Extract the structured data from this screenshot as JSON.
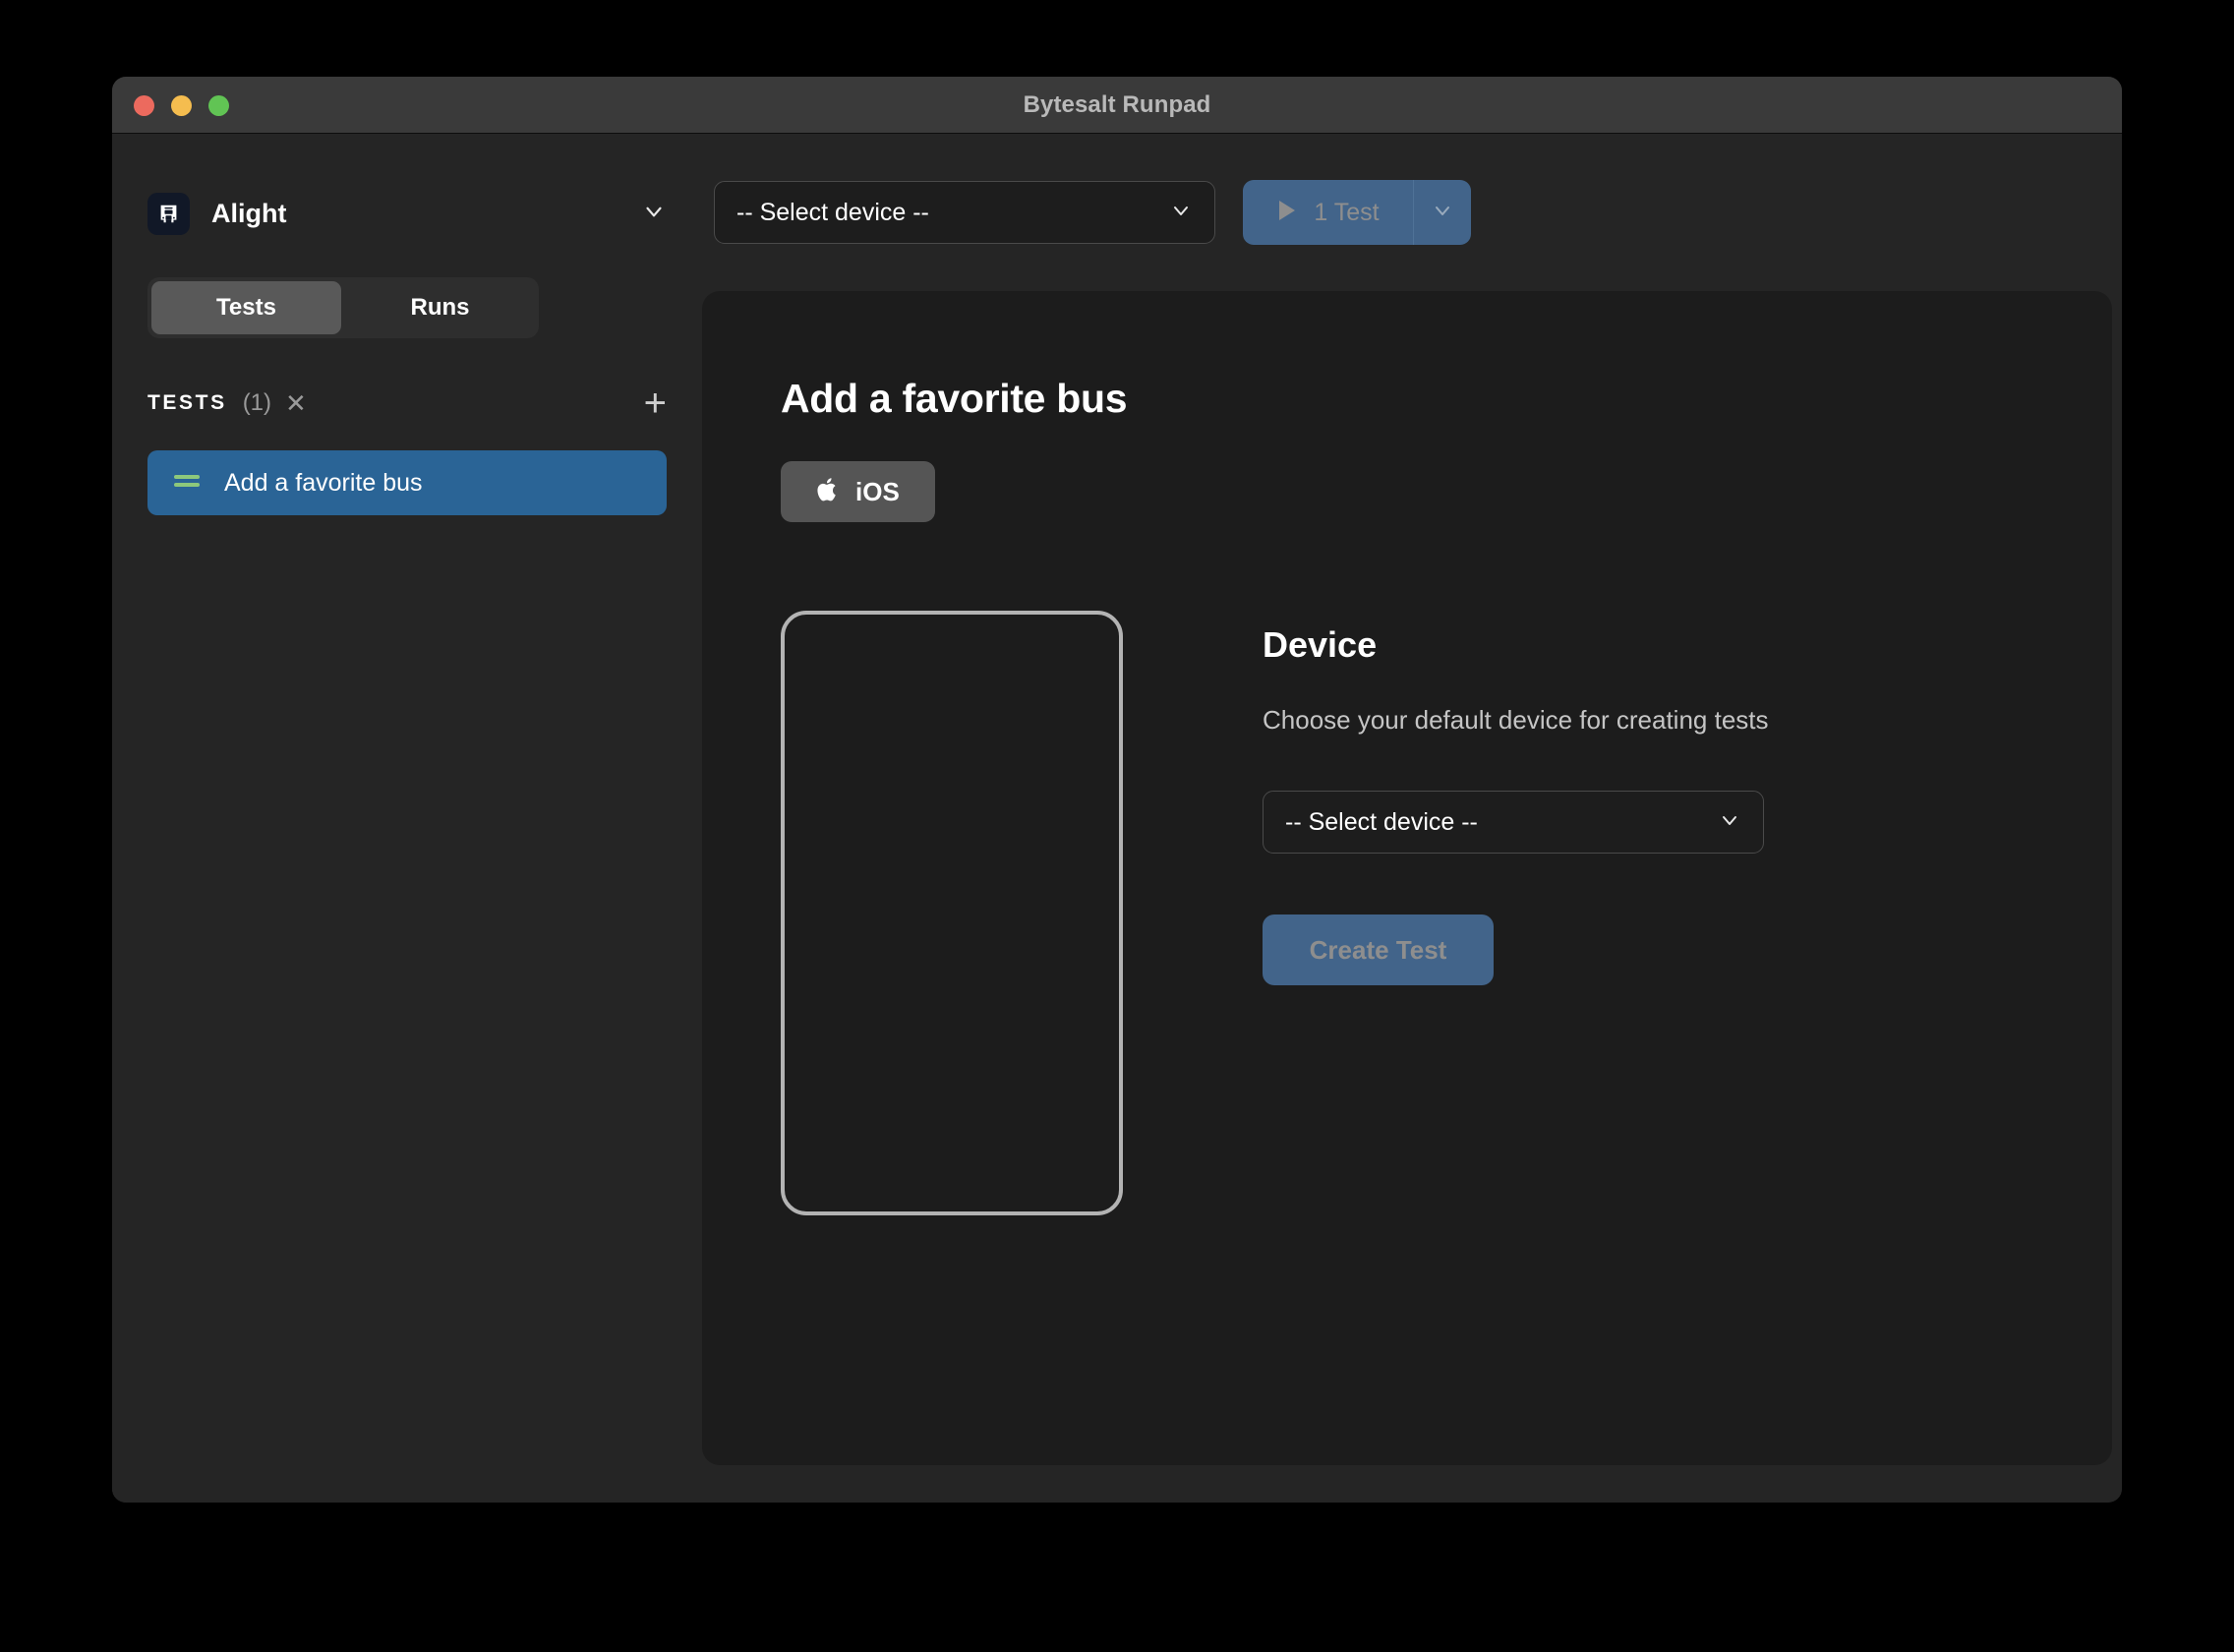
{
  "window": {
    "title": "Bytesalt Runpad",
    "traffic_lights": [
      {
        "name": "close",
        "color": "#ec6a5e"
      },
      {
        "name": "minimize",
        "color": "#f5bd4f"
      },
      {
        "name": "maximize",
        "color": "#61c454"
      }
    ]
  },
  "sidebar": {
    "project": {
      "name": "Alight",
      "logo_icon": "bus-icon",
      "chevron_icon": "chevron-down-icon"
    },
    "tabs": [
      {
        "label": "Tests",
        "active": true
      },
      {
        "label": "Runs",
        "active": false
      }
    ],
    "tests_section": {
      "label": "TESTS",
      "count": "(1)",
      "clear_icon": "close-icon",
      "add_icon": "plus-icon"
    },
    "tests": [
      {
        "label": "Add a favorite bus",
        "icon": "equals-handle-icon",
        "selected": true
      }
    ]
  },
  "topbar": {
    "device_select": {
      "value": "-- Select device --",
      "chevron_icon": "chevron-down-icon"
    },
    "run_button": {
      "label": "1 Test",
      "play_icon": "play-icon",
      "caret_icon": "chevron-down-icon"
    }
  },
  "main": {
    "title": "Add a favorite bus",
    "platform": {
      "label": "iOS",
      "icon": "apple-icon"
    },
    "phone_preview": {
      "name": "phone-frame"
    },
    "device_panel": {
      "heading": "Device",
      "subtitle": "Choose your default device for creating tests",
      "select_value": "-- Select device --",
      "select_chevron_icon": "chevron-down-icon",
      "create_button": "Create Test"
    }
  },
  "colors": {
    "accent_blue": "#42648a",
    "selected_item": "#2a6496",
    "panel_bg": "#1c1c1c",
    "window_bg": "#252525",
    "titlebar_bg": "#3a3a3a",
    "green_handle": "#8dc87c"
  }
}
